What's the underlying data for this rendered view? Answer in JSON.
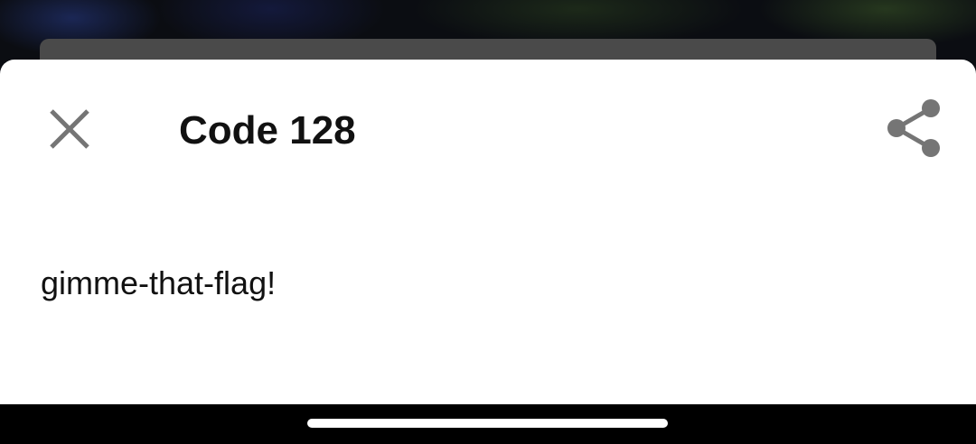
{
  "sheet": {
    "title": "Code 128",
    "content": "gimme-that-flag!",
    "close_icon": "close-icon",
    "share_icon": "share-icon"
  },
  "colors": {
    "sheet_background": "#ffffff",
    "icon_color": "#757575",
    "text_color": "#111111",
    "nav_bar": "#000000",
    "home_indicator": "#ffffff"
  }
}
